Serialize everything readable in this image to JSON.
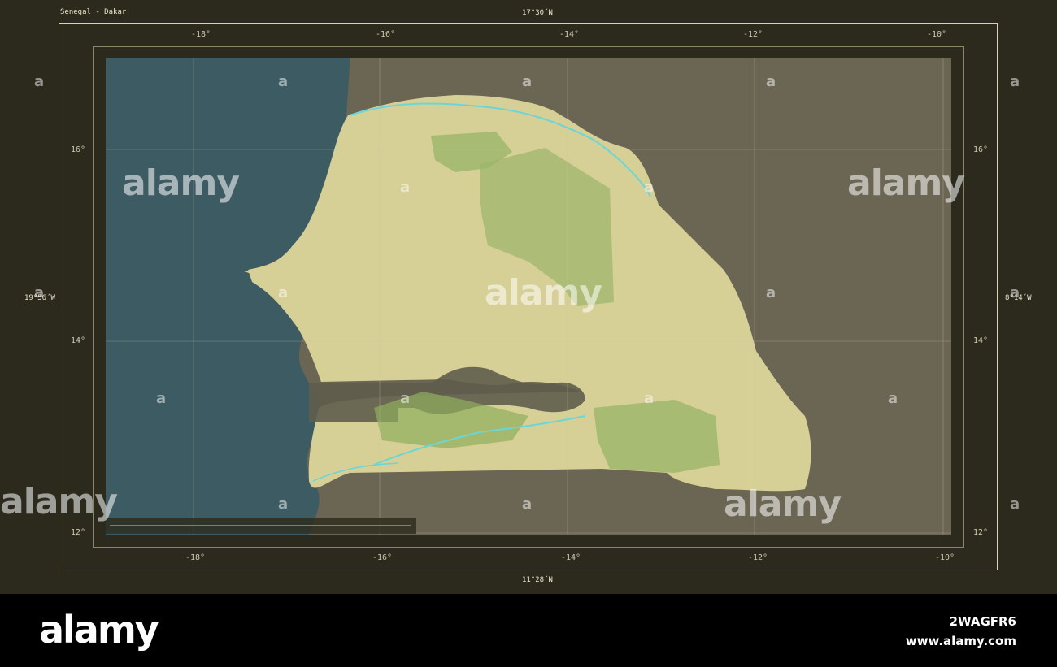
{
  "map": {
    "title": "Senegal - Dakar",
    "lat_top": "17°30´N",
    "lat_bottom": "11°28´N",
    "lon_left": "19°56´W",
    "lon_right": "8°14´W",
    "lon_ticks_top": [
      "-18°",
      "-16°",
      "-14°",
      "-12°",
      "-10°"
    ],
    "lon_ticks_bottom": [
      "-18°",
      "-16°",
      "-14°",
      "-12°",
      "-10°"
    ],
    "lat_ticks_left": [
      "16°",
      "14°",
      "12°"
    ],
    "lat_ticks_right": [
      "16°",
      "14°",
      "12°"
    ],
    "colors": {
      "ocean": "#3d5b63",
      "country": "#d6cf96",
      "neighbors": "#6b6553",
      "protected": "#9bb56a",
      "gambia": "#5f5c4c",
      "frame": "#2c2a1d"
    }
  },
  "watermark": {
    "text": "alamy",
    "small": "a"
  },
  "footer": {
    "brand": "alamy",
    "image_id": "2WAGFR6",
    "url": "www.alamy.com"
  }
}
